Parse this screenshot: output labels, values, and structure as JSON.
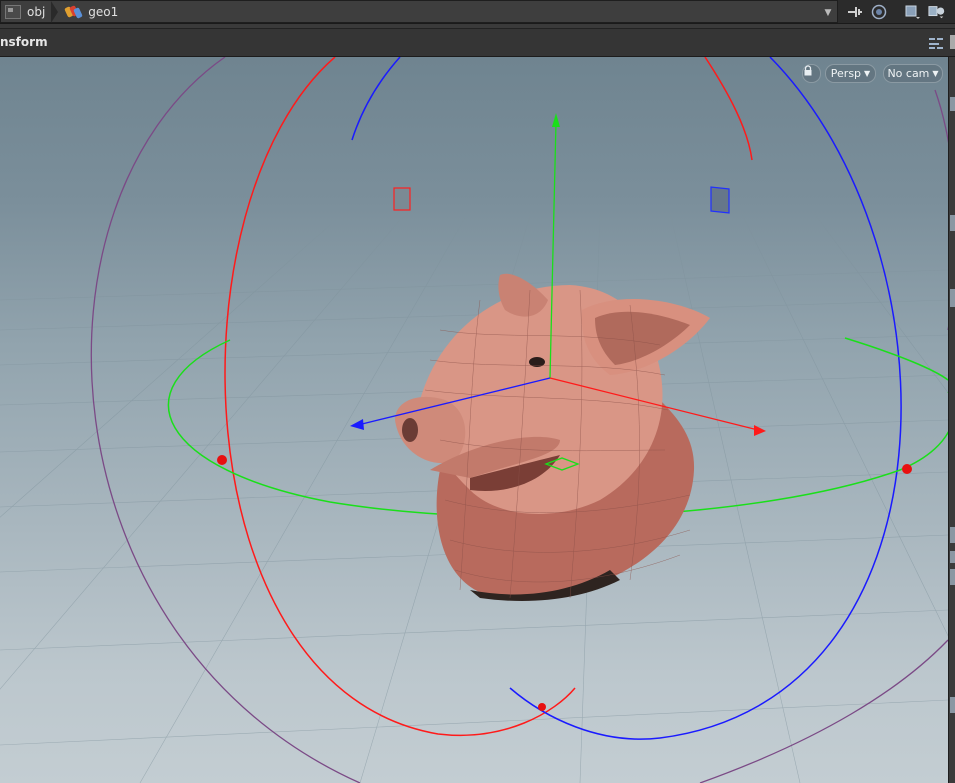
{
  "pathbar": {
    "crumbs": [
      {
        "label": "obj",
        "icon": "network-icon"
      },
      {
        "label": "geo1",
        "icon": "geometry-object-icon"
      }
    ]
  },
  "toolbar": {
    "title_fragment": "nsform"
  },
  "viewport": {
    "lock_icon": "lock-icon",
    "view_menu": "Persp",
    "camera_menu": "No cam",
    "model": "pig head",
    "handle": "transform-handle",
    "colors": {
      "x_axis": "#ff1a1a",
      "y_axis": "#1adf1a",
      "z_axis": "#1a1aff",
      "outer_ring": "#7b4a86",
      "model_tint": "#d99686"
    }
  }
}
